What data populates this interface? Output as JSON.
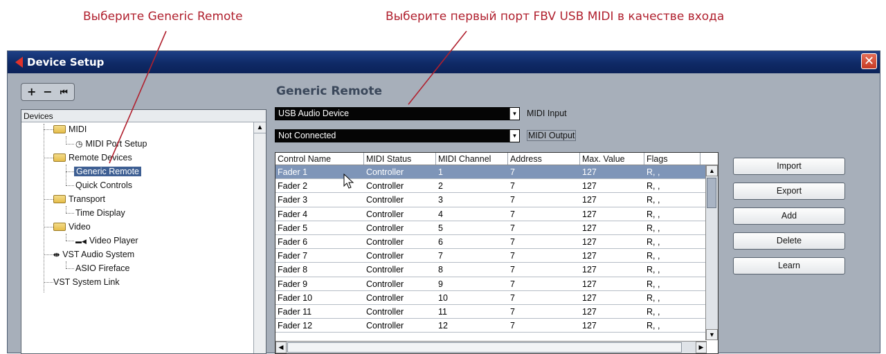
{
  "annotations": {
    "left": "Выберите Generic Remote",
    "right": "Выберите первый порт FBV USB MIDI в качестве входа"
  },
  "colors": {
    "annotation": "#b0202e",
    "titlebar": "#0f2a66",
    "selection": "#3e5f93",
    "row_selected": "#7e95b8"
  },
  "window": {
    "title": "Device Setup",
    "close_icon": "close-icon"
  },
  "toolbar": {
    "add": "+",
    "remove": "−",
    "reset": "⏮"
  },
  "tree": {
    "header": "Devices",
    "items": [
      {
        "label": "MIDI",
        "icon": "folder-icon"
      },
      {
        "label": "MIDI Port Setup",
        "icon": "midi-port-icon"
      },
      {
        "label": "Remote Devices",
        "icon": "folder-icon"
      },
      {
        "label": "Generic Remote"
      },
      {
        "label": "Quick Controls"
      },
      {
        "label": "Transport",
        "icon": "folder-icon"
      },
      {
        "label": "Time Display"
      },
      {
        "label": "Video",
        "icon": "folder-icon"
      },
      {
        "label": "Video Player",
        "icon": "video-icon"
      },
      {
        "label": "VST Audio System",
        "icon": "audio-system-icon"
      },
      {
        "label": "ASIO Fireface"
      },
      {
        "label": "VST System Link"
      }
    ]
  },
  "main": {
    "title": "Generic Remote",
    "midi_input": {
      "value": "USB Audio Device",
      "label": "MIDI Input"
    },
    "midi_output": {
      "value": "Not Connected",
      "label": "MIDI Output"
    }
  },
  "table": {
    "columns": [
      "Control Name",
      "MIDI Status",
      "MIDI Channel",
      "Address",
      "Max. Value",
      "Flags"
    ],
    "rows": [
      [
        "Fader 1",
        "Controller",
        "1",
        "7",
        "127",
        "R, ,"
      ],
      [
        "Fader 2",
        "Controller",
        "2",
        "7",
        "127",
        "R, ,"
      ],
      [
        "Fader 3",
        "Controller",
        "3",
        "7",
        "127",
        "R, ,"
      ],
      [
        "Fader 4",
        "Controller",
        "4",
        "7",
        "127",
        "R, ,"
      ],
      [
        "Fader 5",
        "Controller",
        "5",
        "7",
        "127",
        "R, ,"
      ],
      [
        "Fader 6",
        "Controller",
        "6",
        "7",
        "127",
        "R, ,"
      ],
      [
        "Fader 7",
        "Controller",
        "7",
        "7",
        "127",
        "R, ,"
      ],
      [
        "Fader 8",
        "Controller",
        "8",
        "7",
        "127",
        "R, ,"
      ],
      [
        "Fader 9",
        "Controller",
        "9",
        "7",
        "127",
        "R, ,"
      ],
      [
        "Fader 10",
        "Controller",
        "10",
        "7",
        "127",
        "R, ,"
      ],
      [
        "Fader 11",
        "Controller",
        "11",
        "7",
        "127",
        "R, ,"
      ],
      [
        "Fader 12",
        "Controller",
        "12",
        "7",
        "127",
        "R, ,"
      ]
    ]
  },
  "buttons": {
    "import": "Import",
    "export": "Export",
    "add": "Add",
    "delete": "Delete",
    "learn": "Learn"
  }
}
